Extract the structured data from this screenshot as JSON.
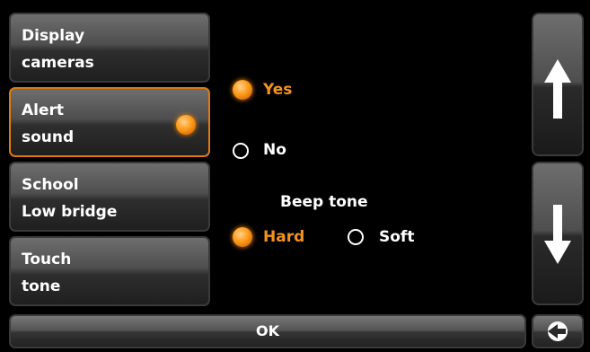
{
  "menu": [
    {
      "line1": "Display",
      "line2": "cameras",
      "selected": false
    },
    {
      "line1": "Alert",
      "line2": "sound",
      "selected": true
    },
    {
      "line1": "School",
      "line2": "Low bridge",
      "selected": false
    },
    {
      "line1": "Touch",
      "line2": "tone",
      "selected": false
    }
  ],
  "alert_sound": {
    "yes_label": "Yes",
    "no_label": "No",
    "selected": "Yes"
  },
  "beep_tone": {
    "heading": "Beep tone",
    "hard_label": "Hard",
    "soft_label": "Soft",
    "selected": "Hard"
  },
  "footer": {
    "ok_label": "OK"
  },
  "icons": {
    "scroll_up": "arrow-up-icon",
    "scroll_down": "arrow-down-icon",
    "back": "back-icon",
    "active_indicator": "orange-orb-icon"
  },
  "colors": {
    "accent": "#f39321",
    "background": "#000000",
    "button_gray": "#4e4e4e"
  }
}
